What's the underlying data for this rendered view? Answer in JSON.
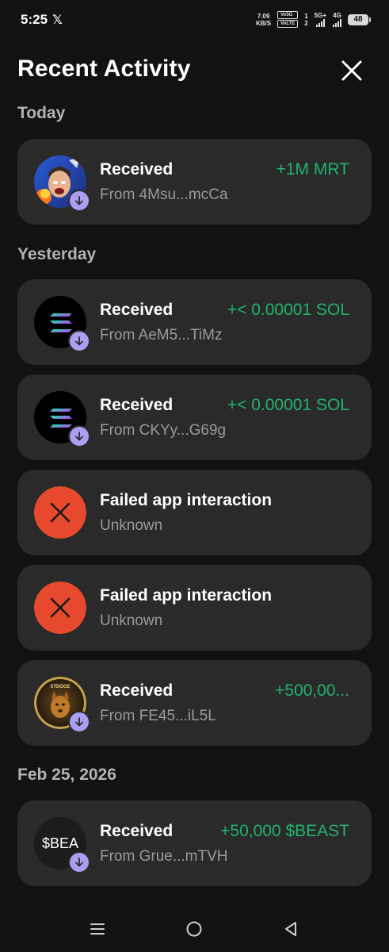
{
  "status_bar": {
    "time": "5:25",
    "x_logo": "𝕏",
    "net_speed_value": "7.09",
    "net_speed_unit": "KB/S",
    "vo5g": "Vo5G",
    "volte": "VoLTE",
    "sim1": "1",
    "sim2": "2",
    "net1": "5G+",
    "net2": "4G",
    "battery": "48"
  },
  "header": {
    "title": "Recent Activity"
  },
  "sections": [
    {
      "label": "Today",
      "items": [
        {
          "title": "Received",
          "subtitle": "From 4Msu...mcCa",
          "amount": "+1M MRT",
          "avatar": "mrt-token-avatar"
        }
      ]
    },
    {
      "label": "Yesterday",
      "items": [
        {
          "title": "Received",
          "subtitle": "From AeM5...TiMz",
          "amount": "+< 0.00001 SOL",
          "avatar": "solana-avatar"
        },
        {
          "title": "Received",
          "subtitle": "From CKYy...G69g",
          "amount": "+< 0.00001 SOL",
          "avatar": "solana-avatar"
        },
        {
          "title": "Failed app interaction",
          "subtitle": "Unknown",
          "amount": "",
          "avatar": "failed-icon"
        },
        {
          "title": "Failed app interaction",
          "subtitle": "Unknown",
          "amount": "",
          "avatar": "failed-icon"
        },
        {
          "title": "Received",
          "subtitle": "From FE45...iL5L",
          "amount": "+500,00...",
          "avatar": "stdoge-avatar"
        }
      ]
    },
    {
      "label": "Feb 25, 2026",
      "items": [
        {
          "title": "Received",
          "subtitle": "From Grue...mTVH",
          "amount": "+50,000 $BEAST",
          "avatar": "beast-avatar",
          "avatar_text": "$BEA"
        }
      ]
    }
  ],
  "avatar_texts": {
    "stdoge": "STDOGE"
  },
  "colors": {
    "background": "#121212",
    "card": "#2a2a2a",
    "positive": "#21b36e",
    "badge": "#ab9ff2",
    "failed": "#e6492d",
    "section_label": "#b3b3b3"
  }
}
